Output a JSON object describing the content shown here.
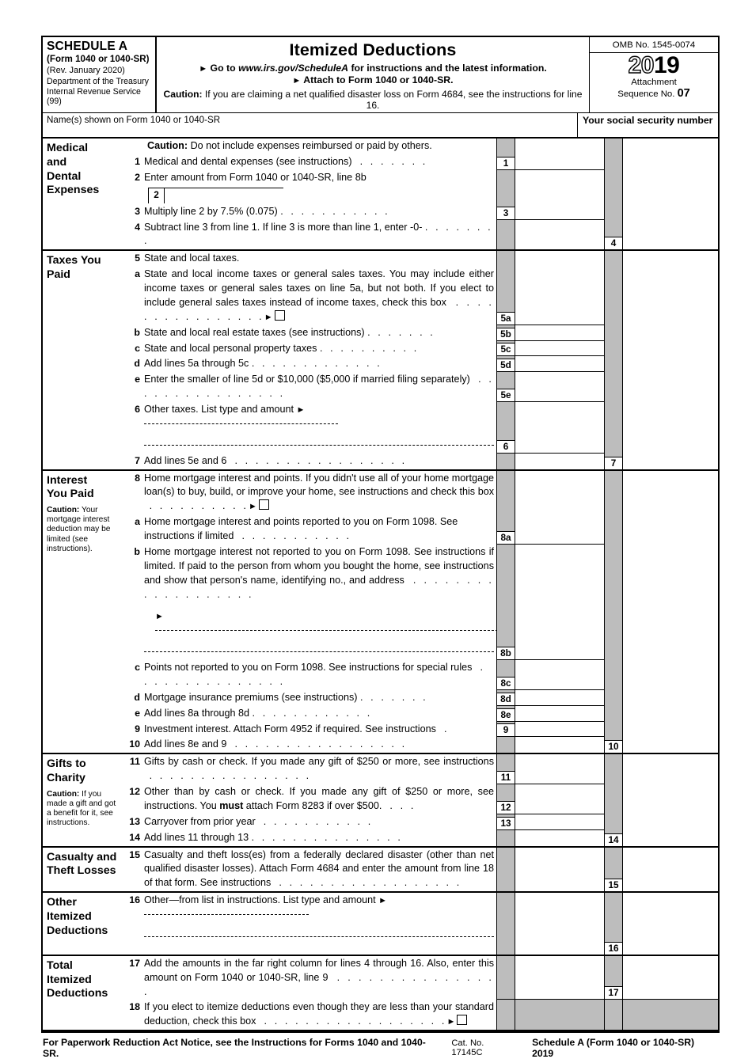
{
  "header": {
    "schedule_title": "SCHEDULE A",
    "schedule_form": "(Form 1040 or 1040-SR)",
    "revision": "(Rev. January 2020)",
    "dept_line1": "Department of the Treasury",
    "dept_line2": "Internal Revenue Service (99)",
    "form_title": "Itemized Deductions",
    "goto_prefix": "Go to",
    "goto_url": "www.irs.gov/ScheduleA",
    "goto_suffix": "for instructions and the latest information.",
    "attach_to": "Attach to Form 1040 or 1040-SR.",
    "caution_label": "Caution:",
    "caution_text": "If you are claiming a net qualified disaster loss on Form 4684, see the instructions for line 16.",
    "omb": "OMB No. 1545-0074",
    "year_hollow": "20",
    "year_solid": "19",
    "attachment_label_line1": "Attachment",
    "attachment_label_line2": "Sequence No.",
    "attachment_no": "07",
    "name_label": "Name(s) shown on Form 1040 or 1040-SR",
    "ssn_label": "Your social security number"
  },
  "sections": {
    "medical": {
      "label_lines": [
        "Medical",
        "and",
        "Dental",
        "Expenses"
      ],
      "caution_label": "Caution:",
      "caution_text": "Do not include expenses reimbursed or paid by others.",
      "line1_num": "1",
      "line1_text": "Medical and dental expenses (see instructions)",
      "line1_tag": "1",
      "line2_num": "2",
      "line2_text": "Enter amount from Form 1040 or 1040-SR, line 8b",
      "line2_inline_tag": "2",
      "line3_num": "3",
      "line3_text": "Multiply line 2 by 7.5% (0.075)",
      "line3_tag": "3",
      "line4_num": "4",
      "line4_text": "Subtract line 3 from line 1. If line 3 is more than line 1, enter -0-",
      "line4_tag": "4"
    },
    "taxes": {
      "label_lines": [
        "Taxes You",
        "Paid"
      ],
      "line5_num": "5",
      "line5_text": "State and local taxes.",
      "line5a_num": "a",
      "line5a_text": "State and local income taxes or general sales taxes. You may include either income taxes or general sales taxes on line 5a, but not both. If you elect to include general sales taxes instead of income taxes, check this box",
      "line5a_tag": "5a",
      "line5b_num": "b",
      "line5b_text": "State and local real estate taxes (see instructions)",
      "line5b_tag": "5b",
      "line5c_num": "c",
      "line5c_text": "State and local personal property taxes",
      "line5c_tag": "5c",
      "line5d_num": "d",
      "line5d_text": "Add lines 5a through 5c",
      "line5d_tag": "5d",
      "line5e_num": "e",
      "line5e_text": "Enter the smaller of line 5d or $10,000 ($5,000 if married filing separately)",
      "line5e_tag": "5e",
      "line6_num": "6",
      "line6_text": "Other taxes. List type and amount",
      "line6_tag": "6",
      "line7_num": "7",
      "line7_text": "Add lines 5e and 6",
      "line7_tag": "7"
    },
    "interest": {
      "label_lines": [
        "Interest",
        "You Paid"
      ],
      "caution_label": "Caution:",
      "caution_text": "Your mortgage interest deduction may be limited (see instructions).",
      "line8_num": "8",
      "line8_text": "Home mortgage interest and points. If you didn't use all of your home mortgage loan(s) to buy, build, or improve your home, see instructions and check this box",
      "line8a_num": "a",
      "line8a_text": "Home mortgage interest and points reported to you on Form 1098. See instructions if limited",
      "line8a_tag": "8a",
      "line8b_num": "b",
      "line8b_text": "Home mortgage interest not reported to you on Form 1098. See instructions if limited. If paid to the person from whom you bought the home, see instructions and show that person's name, identifying no., and address",
      "line8b_tag": "8b",
      "line8c_num": "c",
      "line8c_text": "Points not reported to you on Form 1098. See instructions for special rules",
      "line8c_tag": "8c",
      "line8d_num": "d",
      "line8d_text": "Mortgage insurance premiums (see instructions)",
      "line8d_tag": "8d",
      "line8e_num": "e",
      "line8e_text": "Add lines 8a through 8d",
      "line8e_tag": "8e",
      "line9_num": "9",
      "line9_text": "Investment interest. Attach Form 4952 if required. See instructions",
      "line9_tag": "9",
      "line10_num": "10",
      "line10_text": "Add lines 8e and 9",
      "line10_tag": "10"
    },
    "gifts": {
      "label_lines": [
        "Gifts to",
        "Charity"
      ],
      "caution_label": "Caution:",
      "caution_text": "If you made a gift and got a benefit for it, see instructions.",
      "line11_num": "11",
      "line11_text": "Gifts by cash or check. If you made any gift of $250 or more, see instructions",
      "line11_tag": "11",
      "line12_num": "12",
      "line12_text_a": "Other than by cash or check. If you made any gift of $250 or more, see instructions. You ",
      "line12_must": "must",
      "line12_text_b": " attach Form 8283 if over $500.",
      "line12_tag": "12",
      "line13_num": "13",
      "line13_text": "Carryover from prior year",
      "line13_tag": "13",
      "line14_num": "14",
      "line14_text": "Add lines 11 through 13",
      "line14_tag": "14"
    },
    "casualty": {
      "label_lines": [
        "Casualty and",
        "Theft Losses"
      ],
      "line15_num": "15",
      "line15_text": "Casualty and theft loss(es) from a federally declared disaster (other than net qualified disaster losses). Attach Form 4684 and enter the amount from line 18 of that form. See instructions",
      "line15_tag": "15"
    },
    "other": {
      "label_lines": [
        "Other",
        "Itemized",
        "Deductions"
      ],
      "line16_num": "16",
      "line16_text": "Other—from list in instructions. List type and amount",
      "line16_tag": "16"
    },
    "total": {
      "label_lines": [
        "Total",
        "Itemized",
        "Deductions"
      ],
      "line17_num": "17",
      "line17_text": "Add the amounts in the far right column for lines 4 through 16. Also, enter this amount on Form 1040 or 1040-SR, line 9",
      "line17_tag": "17",
      "line18_num": "18",
      "line18_text": "If you elect to itemize deductions even though they are less than your standard deduction, check this box"
    }
  },
  "footer": {
    "paperwork": "For Paperwork Reduction Act Notice, see the Instructions for Forms 1040 and 1040-SR.",
    "cat_no": "Cat. No. 17145C",
    "schedule_ref": "Schedule A (Form 1040 or 1040-SR) 2019"
  }
}
